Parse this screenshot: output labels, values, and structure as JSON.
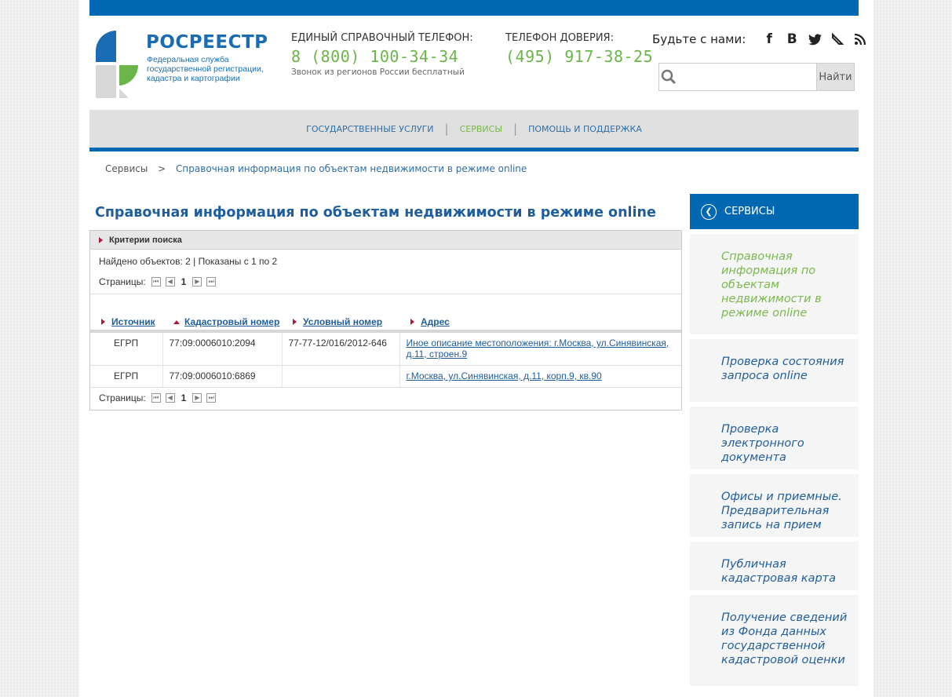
{
  "header": {
    "logo_title": "РОСРЕЕСТР",
    "logo_subtitle": "Федеральная служба государственной регистрации, кадастра и картографии",
    "phone1_label": "ЕДИНЫЙ СПРАВОЧНЫЙ ТЕЛЕФОН:",
    "phone1_number": "8 (800) 100-34-34",
    "phone1_note": "Звонок из регионов России бесплатный",
    "phone2_label": "ТЕЛЕФОН ДОВЕРИЯ:",
    "phone2_number": "(495) 917-38-25",
    "social_label": "Будьте с нами:",
    "social_icons": [
      "facebook-icon",
      "vkontakte-icon",
      "twitter-icon",
      "livejournal-icon",
      "rss-icon"
    ],
    "search_placeholder": "",
    "search_button": "Найти"
  },
  "nav": {
    "items": [
      {
        "label": "ГОСУДАРСТВЕННЫЕ УСЛУГИ",
        "active": false
      },
      {
        "label": "СЕРВИСЫ",
        "active": true
      },
      {
        "label": "ПОМОЩЬ И ПОДДЕРЖКА",
        "active": false
      }
    ]
  },
  "breadcrumb": {
    "root": "Сервисы",
    "separator": ">",
    "current": "Справочная информация по объектам недвижимости в режиме online"
  },
  "main": {
    "title": "Справочная информация по объектам недвижимости в режиме online",
    "criteria_label": "Критерии поиска",
    "found_text": "Найдено объектов: 2 | Показаны с 1 по 2",
    "pages_label": "Страницы:",
    "current_page": "1",
    "columns": [
      "Источник",
      "Кадастровый номер",
      "Условный номер",
      "Адрес"
    ],
    "rows": [
      {
        "source": "ЕГРП",
        "cadastral": "77:09:0006010:2094",
        "conditional": "77-77-12/016/2012-646",
        "address": "Иное описание местоположения: г.Москва, ул.Синявинская, д.11, строен.9"
      },
      {
        "source": "ЕГРП",
        "cadastral": "77:09:0006010:6869",
        "conditional": "",
        "address": "г.Москва, ул.Синявинская, д.11, корп.9, кв.90"
      }
    ]
  },
  "sidebar": {
    "title": "СЕРВИСЫ",
    "items": [
      {
        "label": "Справочная информация по объектам недвижимости в режиме online",
        "active": true
      },
      {
        "label": "Проверка состояния запроса online",
        "active": false
      },
      {
        "label": "Проверка электронного документа",
        "active": false
      },
      {
        "label": "Офисы и приемные. Предварительная запись на прием",
        "active": false
      },
      {
        "label": "Публичная кадастровая карта",
        "active": false
      },
      {
        "label": "Получение сведений из Фонда данных государственной кадастровой оценки",
        "active": false
      }
    ]
  },
  "colors": {
    "brand_blue": "#0068b3",
    "accent_green": "#6bb54a",
    "link_blue": "#1f5d9b"
  }
}
